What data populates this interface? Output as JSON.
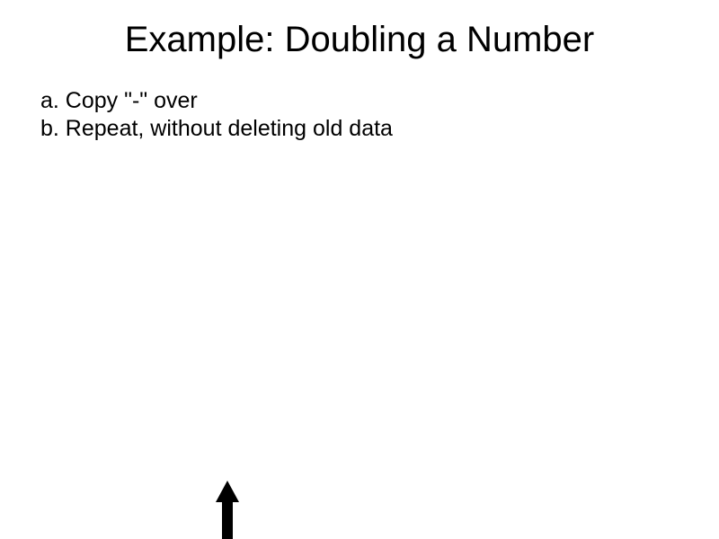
{
  "slide": {
    "title": "Example: Doubling a Number",
    "items": [
      {
        "marker": "a. ",
        "text": "Copy \"-\" over"
      },
      {
        "marker": "b. ",
        "text": "Repeat, without deleting old data"
      }
    ]
  }
}
